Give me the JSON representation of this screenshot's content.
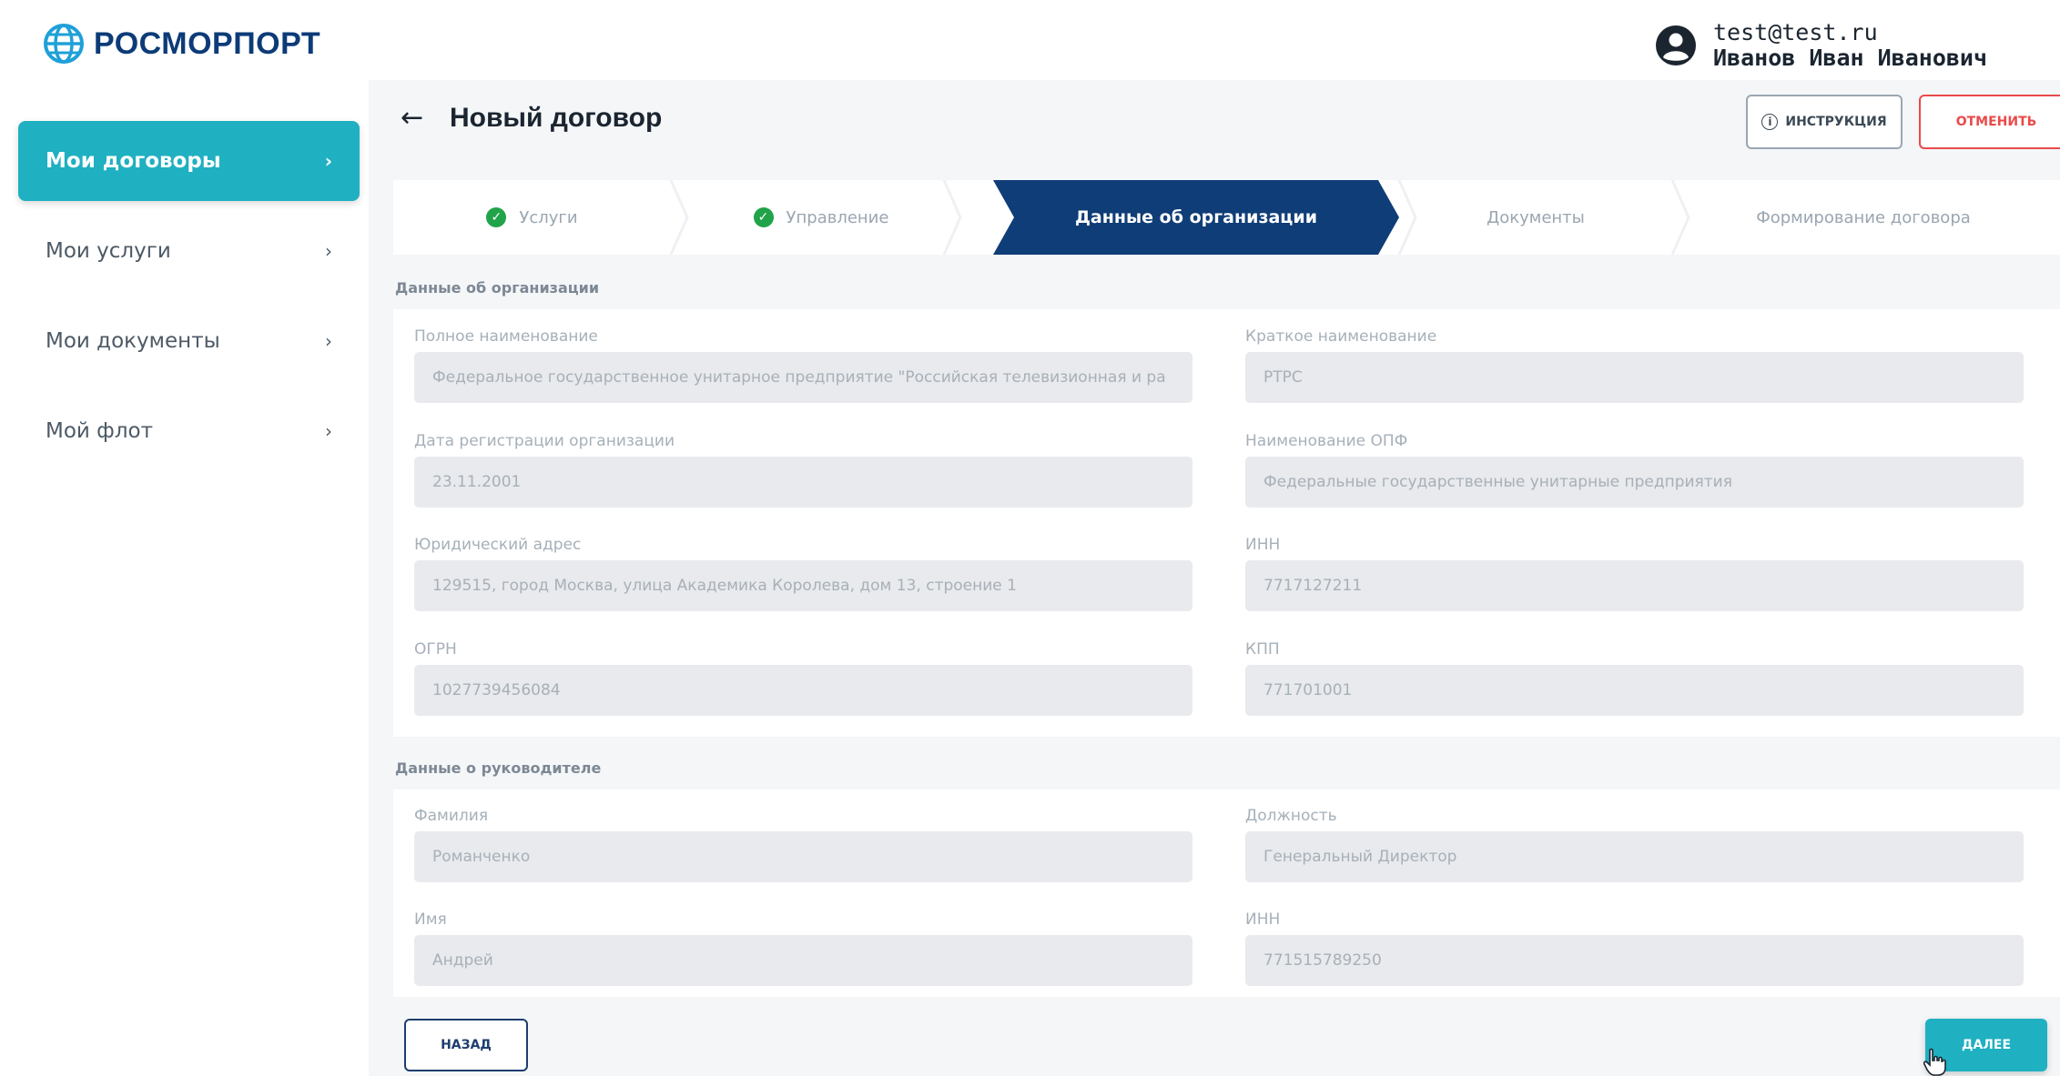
{
  "brand": {
    "name": "РОСМОРПОРТ",
    "color": "#0d3b78"
  },
  "user": {
    "email": "test@test.ru",
    "name": "Иванов Иван Иванович"
  },
  "sidebar": {
    "items": [
      {
        "label": "Мои договоры",
        "active": true
      },
      {
        "label": "Мои услуги",
        "active": false
      },
      {
        "label": "Мои документы",
        "active": false
      },
      {
        "label": "Мой флот",
        "active": false
      }
    ]
  },
  "header": {
    "title": "Новый договор",
    "instruction_label": "ИНСТРУКЦИЯ",
    "cancel_label": "ОТМЕНИТЬ"
  },
  "stepper": {
    "steps": [
      {
        "label": "Услуги",
        "state": "done"
      },
      {
        "label": "Управление",
        "state": "done"
      },
      {
        "label": "Данные об организации",
        "state": "active"
      },
      {
        "label": "Документы",
        "state": "pending"
      },
      {
        "label": "Формирование договора",
        "state": "pending"
      }
    ]
  },
  "organization": {
    "section_title": "Данные об организации",
    "fields": {
      "full_name": {
        "label": "Полное наименование",
        "value": "Федеральное государственное унитарное предприятие \"Российская телевизионная и ра"
      },
      "short_name": {
        "label": "Краткое наименование",
        "value": "РТРС"
      },
      "reg_date": {
        "label": "Дата регистрации организации",
        "value": "23.11.2001"
      },
      "opf": {
        "label": "Наименование ОПФ",
        "value": "Федеральные государственные унитарные предприятия"
      },
      "address": {
        "label": "Юридический адрес",
        "value": "129515, город Москва, улица Академика Королева, дом 13, строение 1"
      },
      "inn": {
        "label": "ИНН",
        "value": "7717127211"
      },
      "ogrn": {
        "label": "ОГРН",
        "value": "1027739456084"
      },
      "kpp": {
        "label": "КПП",
        "value": "771701001"
      }
    }
  },
  "director": {
    "section_title": "Данные о руководителе",
    "fields": {
      "last_name": {
        "label": "Фамилия",
        "value": "Романченко"
      },
      "position": {
        "label": "Должность",
        "value": "Генеральный Директор"
      },
      "first_name": {
        "label": "Имя",
        "value": "Андрей"
      },
      "inn": {
        "label": "ИНН",
        "value": "771515789250"
      }
    }
  },
  "footer": {
    "back_label": "НАЗАД",
    "next_label": "ДАЛЕЕ"
  },
  "colors": {
    "accent": "#1fb0c1",
    "stepper_active": "#0f3d77",
    "success": "#21a34a",
    "danger": "#e94a4a"
  }
}
